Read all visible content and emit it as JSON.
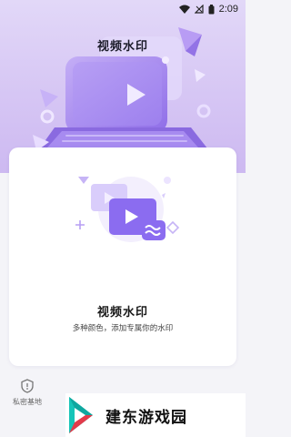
{
  "status_bar": {
    "time": "2:09",
    "icons": [
      "wifi-icon",
      "sim-icon",
      "battery-icon"
    ]
  },
  "header": {
    "title": "视频水印"
  },
  "card": {
    "title": "视频水印",
    "subtitle": "多种颜色，添加专属你的水印"
  },
  "bottom_nav": {
    "item_label": "私密基地",
    "item_icon": "shield-icon"
  },
  "watermark": {
    "text": "建东游戏园"
  },
  "colors": {
    "accent": "#8b6cf0",
    "header_bg": "#d6c6f4",
    "card_bg": "#ffffff",
    "page_bg": "#f4f4f8"
  }
}
